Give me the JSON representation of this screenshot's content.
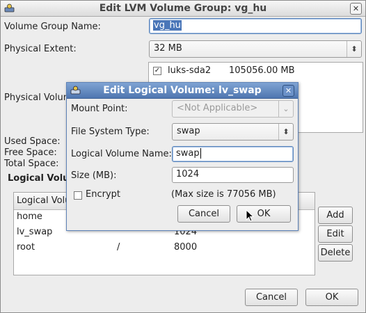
{
  "outer": {
    "title": "Edit LVM Volume Group: vg_hu",
    "close_glyph": "✕",
    "labels": {
      "vg_name": "Volume Group Name:",
      "pe": "Physical Extent:",
      "pv": "Physical Volum",
      "used": "Used Space:",
      "free": "Free Space:",
      "total": "Total Space:",
      "lv_section": "Logical Volu"
    },
    "vg_name_value": "vg_hu",
    "pe_value": "32 MB",
    "pv_item": {
      "checked": true,
      "name": "luks-sda2",
      "size": "105056.00 MB"
    },
    "lv_table": {
      "header": "Logical Volu",
      "rows": [
        {
          "name": "home",
          "mount": "",
          "size": ""
        },
        {
          "name": "lv_swap",
          "mount": "",
          "size": "1024"
        },
        {
          "name": "root",
          "mount": "/",
          "size": "8000"
        }
      ]
    },
    "buttons": {
      "add": "Add",
      "edit": "Edit",
      "delete": "Delete",
      "cancel": "Cancel",
      "ok": "OK"
    }
  },
  "dialog": {
    "title": "Edit Logical Volume: lv_swap",
    "close_glyph": "✕",
    "labels": {
      "mount": "Mount Point:",
      "fstype": "File System Type:",
      "lvname": "Logical Volume Name:",
      "size": "Size (MB):",
      "encrypt": "Encrypt"
    },
    "mount_value": "<Not Applicable>",
    "fstype_value": "swap",
    "lvname_value": "swap",
    "size_value": "1024",
    "max_size_text": "(Max size is 77056 MB)",
    "encrypt_checked": false,
    "buttons": {
      "cancel": "Cancel",
      "ok": "OK"
    }
  },
  "colors": {
    "dialog_title": "#4f76b0",
    "selection": "#4a76b8",
    "focus_border": "#5f88bd"
  }
}
